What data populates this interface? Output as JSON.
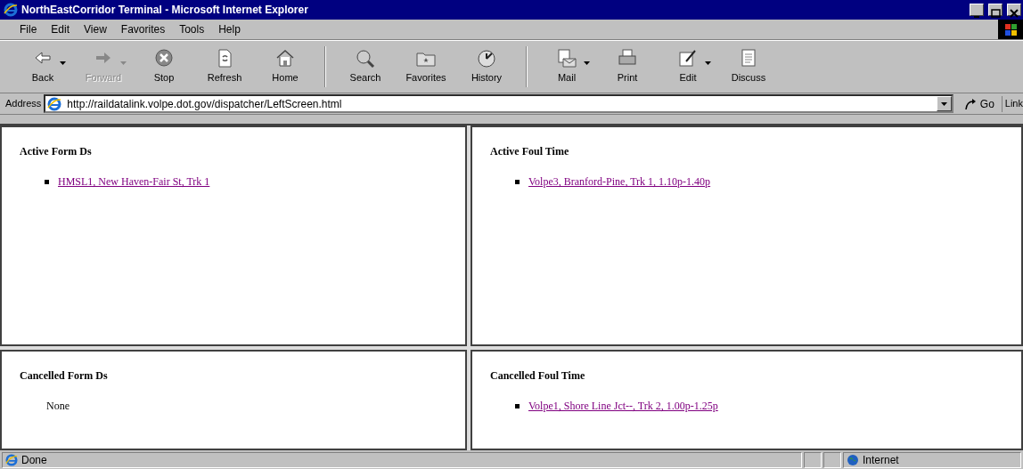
{
  "window": {
    "title": "NorthEastCorridor Terminal - Microsoft Internet Explorer"
  },
  "menu": [
    "File",
    "Edit",
    "View",
    "Favorites",
    "Tools",
    "Help"
  ],
  "toolbar_groups": [
    [
      {
        "label": "Back",
        "kind": "back",
        "dropdown": true,
        "disabled": false
      },
      {
        "label": "Forward",
        "kind": "forward",
        "dropdown": true,
        "disabled": true
      },
      {
        "label": "Stop",
        "kind": "stop",
        "dropdown": false,
        "disabled": false
      },
      {
        "label": "Refresh",
        "kind": "refresh",
        "dropdown": false,
        "disabled": false
      },
      {
        "label": "Home",
        "kind": "home",
        "dropdown": false,
        "disabled": false
      }
    ],
    [
      {
        "label": "Search",
        "kind": "search",
        "dropdown": false,
        "disabled": false
      },
      {
        "label": "Favorites",
        "kind": "favorites",
        "dropdown": false,
        "disabled": false
      },
      {
        "label": "History",
        "kind": "history",
        "dropdown": false,
        "disabled": false
      }
    ],
    [
      {
        "label": "Mail",
        "kind": "mail",
        "dropdown": true,
        "disabled": false
      },
      {
        "label": "Print",
        "kind": "print",
        "dropdown": false,
        "disabled": false
      },
      {
        "label": "Edit",
        "kind": "edit",
        "dropdown": true,
        "disabled": false
      },
      {
        "label": "Discuss",
        "kind": "discuss",
        "dropdown": false,
        "disabled": false
      }
    ]
  ],
  "address_bar": {
    "label": "Address",
    "value": "http://raildatalink.volpe.dot.gov/dispatcher/LeftScreen.html",
    "go": "Go",
    "links": "Link"
  },
  "frames": [
    {
      "heading": "Active Form Ds",
      "items": [
        {
          "kind": "link",
          "text": "HMSL1, New Haven-Fair St, Trk 1"
        }
      ]
    },
    {
      "heading": "Active Foul Time",
      "items": [
        {
          "kind": "link",
          "text": "Volpe3, Branford-Pine, Trk 1, 1.10p-1.40p"
        }
      ]
    },
    {
      "heading": "Cancelled Form Ds",
      "items": [
        {
          "kind": "text",
          "text": "None"
        }
      ]
    },
    {
      "heading": "Cancelled Foul Time",
      "items": [
        {
          "kind": "link",
          "text": "Volpe1, Shore Line Jct--, Trk 2, 1.00p-1.25p"
        }
      ]
    }
  ],
  "status_bar": {
    "text": "Done",
    "zone": "Internet"
  }
}
